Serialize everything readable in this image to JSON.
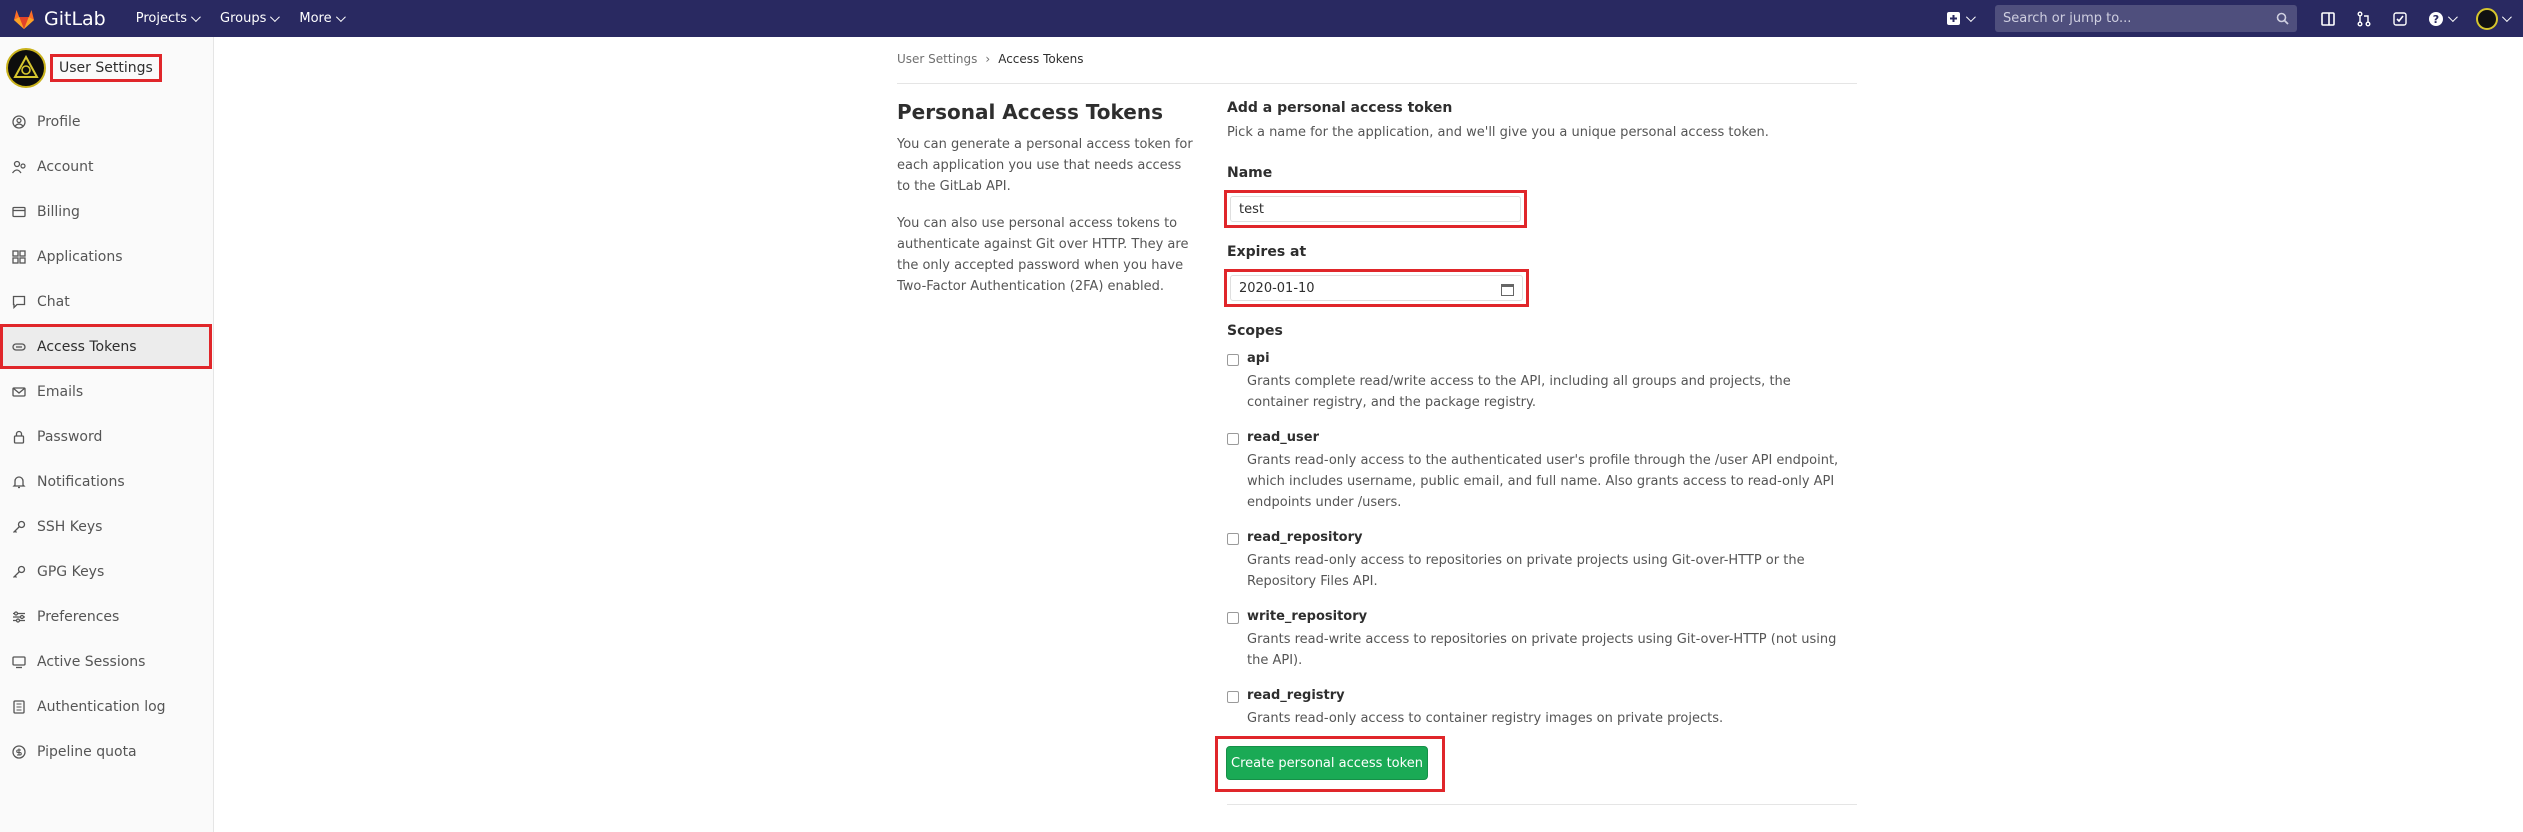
{
  "navbar": {
    "app_name": "GitLab",
    "menu": [
      "Projects",
      "Groups",
      "More"
    ],
    "search_placeholder": "Search or jump to...",
    "brand_color": "#292961"
  },
  "sidebar": {
    "title": "User Settings",
    "items": [
      {
        "label": "Profile",
        "icon": "profile-icon"
      },
      {
        "label": "Account",
        "icon": "account-icon"
      },
      {
        "label": "Billing",
        "icon": "billing-icon"
      },
      {
        "label": "Applications",
        "icon": "applications-icon"
      },
      {
        "label": "Chat",
        "icon": "chat-icon"
      },
      {
        "label": "Access Tokens",
        "icon": "token-icon",
        "active": true
      },
      {
        "label": "Emails",
        "icon": "email-icon"
      },
      {
        "label": "Password",
        "icon": "lock-icon"
      },
      {
        "label": "Notifications",
        "icon": "bell-icon"
      },
      {
        "label": "SSH Keys",
        "icon": "key-icon"
      },
      {
        "label": "GPG Keys",
        "icon": "key-icon"
      },
      {
        "label": "Preferences",
        "icon": "preferences-icon"
      },
      {
        "label": "Active Sessions",
        "icon": "sessions-icon"
      },
      {
        "label": "Authentication log",
        "icon": "log-icon"
      },
      {
        "label": "Pipeline quota",
        "icon": "quota-icon"
      }
    ]
  },
  "breadcrumb": {
    "parent": "User Settings",
    "current": "Access Tokens"
  },
  "main": {
    "title": "Personal Access Tokens",
    "desc1": "You can generate a personal access token for each application you use that needs access to the GitLab API.",
    "desc2": "You can also use personal access tokens to authenticate against Git over HTTP. They are the only accepted password when you have Two-Factor Authentication (2FA) enabled."
  },
  "form": {
    "section_title": "Add a personal access token",
    "section_sub": "Pick a name for the application, and we'll give you a unique personal access token.",
    "name_label": "Name",
    "name_value": "test",
    "expires_label": "Expires at",
    "expires_value": "2020-01-10",
    "scopes_label": "Scopes",
    "scopes": [
      {
        "name": "api",
        "desc": "Grants complete read/write access to the API, including all groups and projects, the container registry, and the package registry."
      },
      {
        "name": "read_user",
        "desc": "Grants read-only access to the authenticated user's profile through the /user API endpoint, which includes username, public email, and full name. Also grants access to read-only API endpoints under /users."
      },
      {
        "name": "read_repository",
        "desc": "Grants read-only access to repositories on private projects using Git-over-HTTP or the Repository Files API."
      },
      {
        "name": "write_repository",
        "desc": "Grants read-write access to repositories on private projects using Git-over-HTTP (not using the API)."
      },
      {
        "name": "read_registry",
        "desc": "Grants read-only access to container registry images on private projects."
      }
    ],
    "submit_label": "Create personal access token",
    "submit_color": "#1aaa55",
    "highlight_color": "#e0262a"
  }
}
